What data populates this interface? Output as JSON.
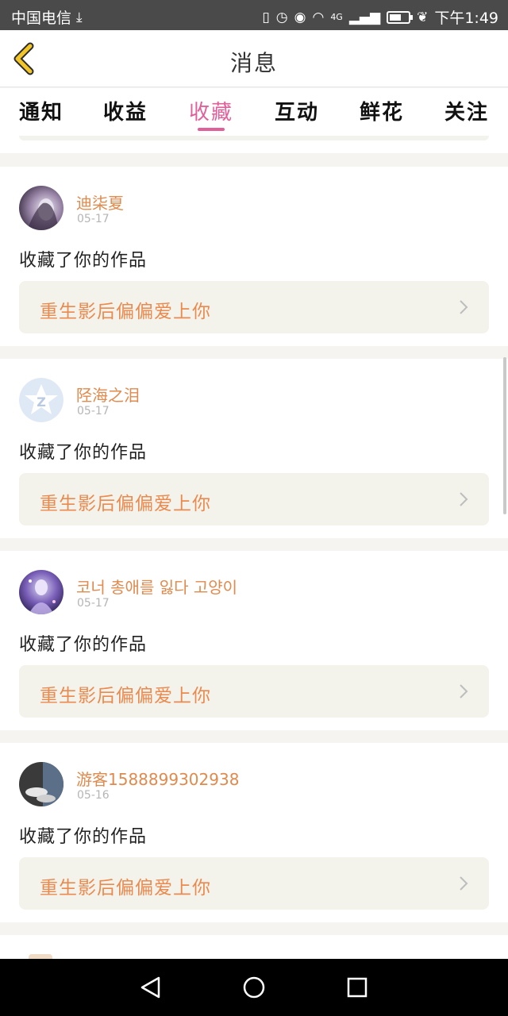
{
  "status_bar": {
    "carrier": "中国电信",
    "download_icon": "download-icon",
    "network": "4G",
    "time": "下午1:49",
    "battery_level": 0.62
  },
  "header": {
    "back_icon": "chevron-left-icon",
    "title": "消息"
  },
  "tabs": [
    {
      "label": "通知",
      "active": false
    },
    {
      "label": "收益",
      "active": false
    },
    {
      "label": "收藏",
      "active": true
    },
    {
      "label": "互动",
      "active": false
    },
    {
      "label": "鲜花",
      "active": false
    },
    {
      "label": "关注",
      "active": false
    }
  ],
  "messages": [
    {
      "username": "迪柒夏",
      "date": "05-17",
      "action": "收藏了你的作品",
      "work_title": "重生影后偏偏爱上你",
      "avatar": "girl-portrait"
    },
    {
      "username": "陉海之泪",
      "date": "05-17",
      "action": "收藏了你的作品",
      "work_title": "重生影后偏偏爱上你",
      "avatar": "qzone-star-logo"
    },
    {
      "username": "코너 총애를 잃다 고양이",
      "date": "05-17",
      "action": "收藏了你的作品",
      "work_title": "重生影后偏偏爱上你",
      "avatar": "anime-girl-purple"
    },
    {
      "username": "游客1588899302938",
      "date": "05-16",
      "action": "收藏了你的作品",
      "work_title": "重生影后偏偏爱上你",
      "avatar": "sneakers-photo"
    }
  ],
  "colors": {
    "accent_pink": "#e0609a",
    "username_orange": "#e08a4e",
    "work_title_orange": "#ea8a4f",
    "work_bg": "#f3f3ec",
    "back_arrow": "#f2c52b"
  }
}
